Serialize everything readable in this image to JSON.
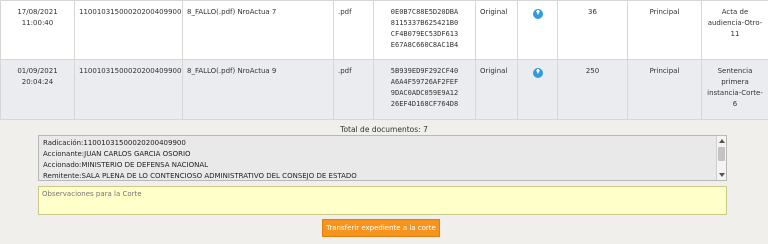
{
  "documents": [
    {
      "date": "17/08/2021",
      "time": "11:00:40",
      "radicado": "11001031500020200409900",
      "filename": "8_FALLO(.pdf) NroActua 7",
      "extension": ".pdf",
      "hash": [
        "0E0B7C88E5D20DBA",
        "8115337B625421B0",
        "CF4B079EC53DF613",
        "E67A8C660C8AC1B4"
      ],
      "origin": "Original",
      "icon": "download-icon",
      "size": "36",
      "type": "Principal",
      "description": "Acta de audiencia-Otro-11"
    },
    {
      "date": "01/09/2021",
      "time": "20:04:24",
      "radicado": "11001031500020200409900",
      "filename": "8_FALLO(.pdf) NroActua 9",
      "extension": ".pdf",
      "hash": [
        "5B939ED9F292CF40",
        "A6A4F59726AF2FEF",
        "9DAC0ADC059E9A12",
        "26EF4D168CF764D8"
      ],
      "origin": "Original",
      "icon": "download-icon",
      "size": "250",
      "type": "Principal",
      "description": "Sentencia primera instancia-Corte-6"
    }
  ],
  "summary": {
    "total_label": "Total de documentos: 7"
  },
  "case_info": {
    "lines": [
      "Radicación:11001031500020200409900",
      "Accionante:JUAN CARLOS GARCIA OSORIO",
      "Accionado:MINISTERIO DE DEFENSA NACIONAL",
      "Remitente:SALA PLENA DE LO CONTENCIOSO ADMINISTRATIVO DEL CONSEJO DE ESTADO"
    ]
  },
  "observations": {
    "placeholder": "Observaciones para la Corte",
    "value": ""
  },
  "actions": {
    "transfer_label": "Transferir expediente a la corte"
  },
  "colors": {
    "accent": "#f7941d",
    "download_icon": "#2f9be0",
    "observations_bg": "#ffffc9"
  }
}
